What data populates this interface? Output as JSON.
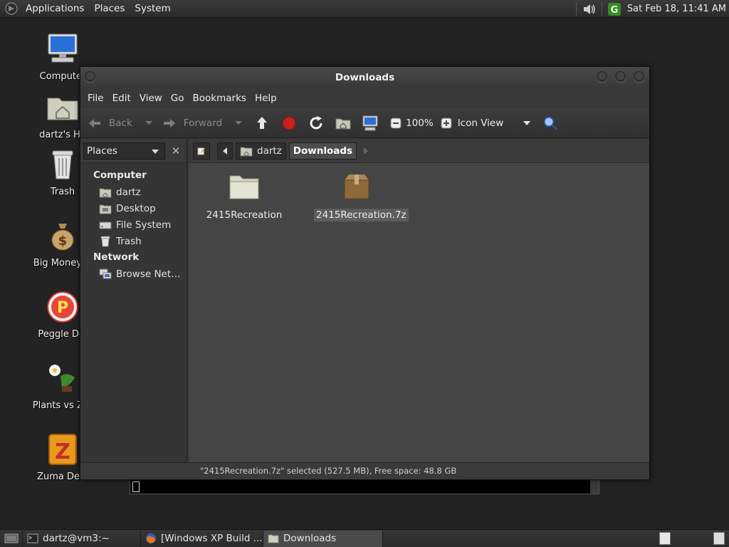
{
  "top_panel": {
    "menus": [
      "Applications",
      "Places",
      "System"
    ],
    "clock": "Sat Feb 18, 11:41 AM"
  },
  "desktop_icons": [
    {
      "label": "Computer",
      "icon": "computer-icon"
    },
    {
      "label": "dartz's Ho",
      "icon": "home-folder-icon"
    },
    {
      "label": "Trash",
      "icon": "trash-icon"
    },
    {
      "label": "Big Money D",
      "icon": "money-bag-icon"
    },
    {
      "label": "Peggle Del",
      "icon": "peggle-icon"
    },
    {
      "label": "Plants vs Zor",
      "icon": "plants-icon"
    },
    {
      "label": "Zuma Delu",
      "icon": "zuma-icon"
    }
  ],
  "window": {
    "title": "Downloads",
    "menubar": [
      "File",
      "Edit",
      "View",
      "Go",
      "Bookmarks",
      "Help"
    ],
    "toolbar": {
      "back": "Back",
      "forward": "Forward",
      "zoom": "100%",
      "view_mode": "Icon View"
    },
    "sidebar": {
      "selector": "Places",
      "sections": [
        {
          "title": "Computer",
          "items": [
            {
              "label": "dartz",
              "icon": "home-icon"
            },
            {
              "label": "Desktop",
              "icon": "desktop-icon"
            },
            {
              "label": "File System",
              "icon": "drive-icon"
            },
            {
              "label": "Trash",
              "icon": "trash-icon"
            }
          ]
        },
        {
          "title": "Network",
          "items": [
            {
              "label": "Browse Net…",
              "icon": "network-icon"
            }
          ]
        }
      ]
    },
    "path": [
      "dartz",
      "Downloads"
    ],
    "files": [
      {
        "name": "2415Recreation",
        "type": "folder"
      },
      {
        "name": "2415Recreation.7z",
        "type": "archive",
        "selected": true
      }
    ],
    "status": "\"2415Recreation.7z\" selected (527.5 MB), Free space: 48.8 GB"
  },
  "taskbar": [
    {
      "label": "dartz@vm3:~",
      "icon": "terminal-icon"
    },
    {
      "label": "[Windows XP Build ...",
      "icon": "firefox-icon"
    },
    {
      "label": "Downloads",
      "icon": "folder-icon",
      "active": true
    }
  ],
  "colors": {
    "panel": "#2f2f2f",
    "content_bg": "#454545",
    "desktop_bg": "#232323"
  }
}
